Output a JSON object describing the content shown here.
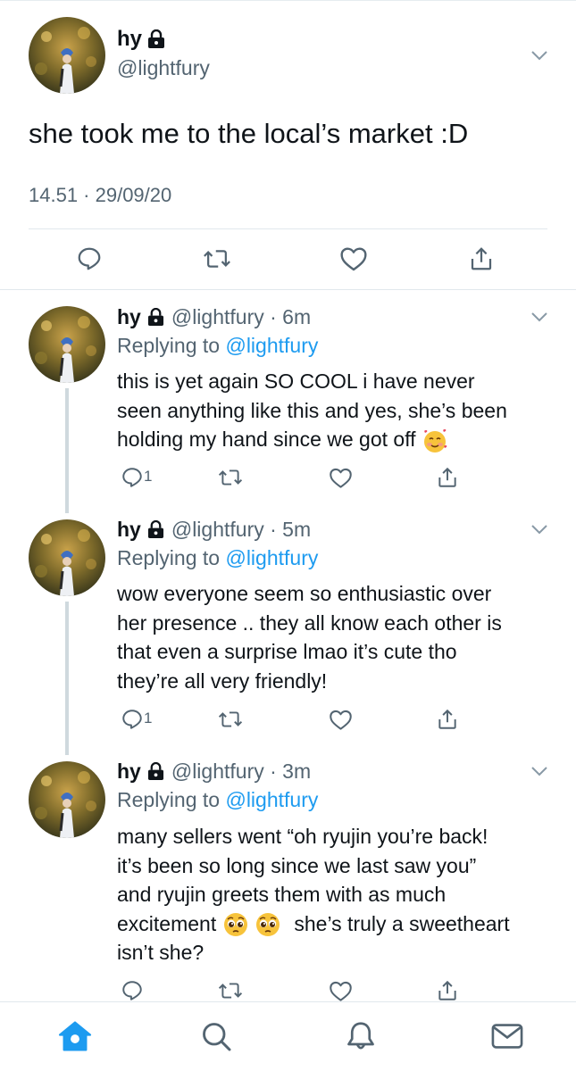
{
  "main_tweet": {
    "name": "hy",
    "handle": "@lightfury",
    "text": "she took me to the local’s market :D",
    "timestamp": "14.51 · 29/09/20",
    "actions": [
      "reply-icon",
      "retweet-icon",
      "like-icon",
      "share-icon"
    ]
  },
  "replies": [
    {
      "name": "hy",
      "meta": "@lightfury · 6m",
      "replying_prefix": "Replying to ",
      "replying_to": "@lightfury",
      "lines": [
        "this is yet again SO COOL i have never",
        "seen anything like this and yes, she’s been",
        "holding my hand since we got off"
      ],
      "emoji": "smiling-face-with-hearts",
      "reply_count": "1"
    },
    {
      "name": "hy",
      "meta": "@lightfury · 5m",
      "replying_prefix": "Replying to ",
      "replying_to": "@lightfury",
      "lines": [
        "wow everyone seem so enthusiastic over",
        "her presence .. they all know each other is",
        "that even a surprise lmao it’s cute tho",
        "they’re all very friendly!"
      ],
      "reply_count": "1"
    },
    {
      "name": "hy",
      "meta": "@lightfury · 3m",
      "replying_prefix": "Replying to ",
      "replying_to": "@lightfury",
      "lines": [
        "many sellers went “oh ryujin you’re back!",
        "it’s been so long since we last saw you”",
        "and ryujin greets them with as much",
        "excitement",
        "she’s truly a sweetheart",
        "isn’t she?"
      ],
      "emoji": "pleading-face",
      "reply_count": ""
    }
  ],
  "bottom_nav": [
    "home-icon",
    "search-icon",
    "notifications-icon",
    "messages-icon"
  ],
  "colors": {
    "accent": "#1d9bf0",
    "secondary_text": "#536471",
    "icon_gray": "#536471",
    "divider": "#e1e8ed",
    "thread_line": "#cfd9de"
  }
}
